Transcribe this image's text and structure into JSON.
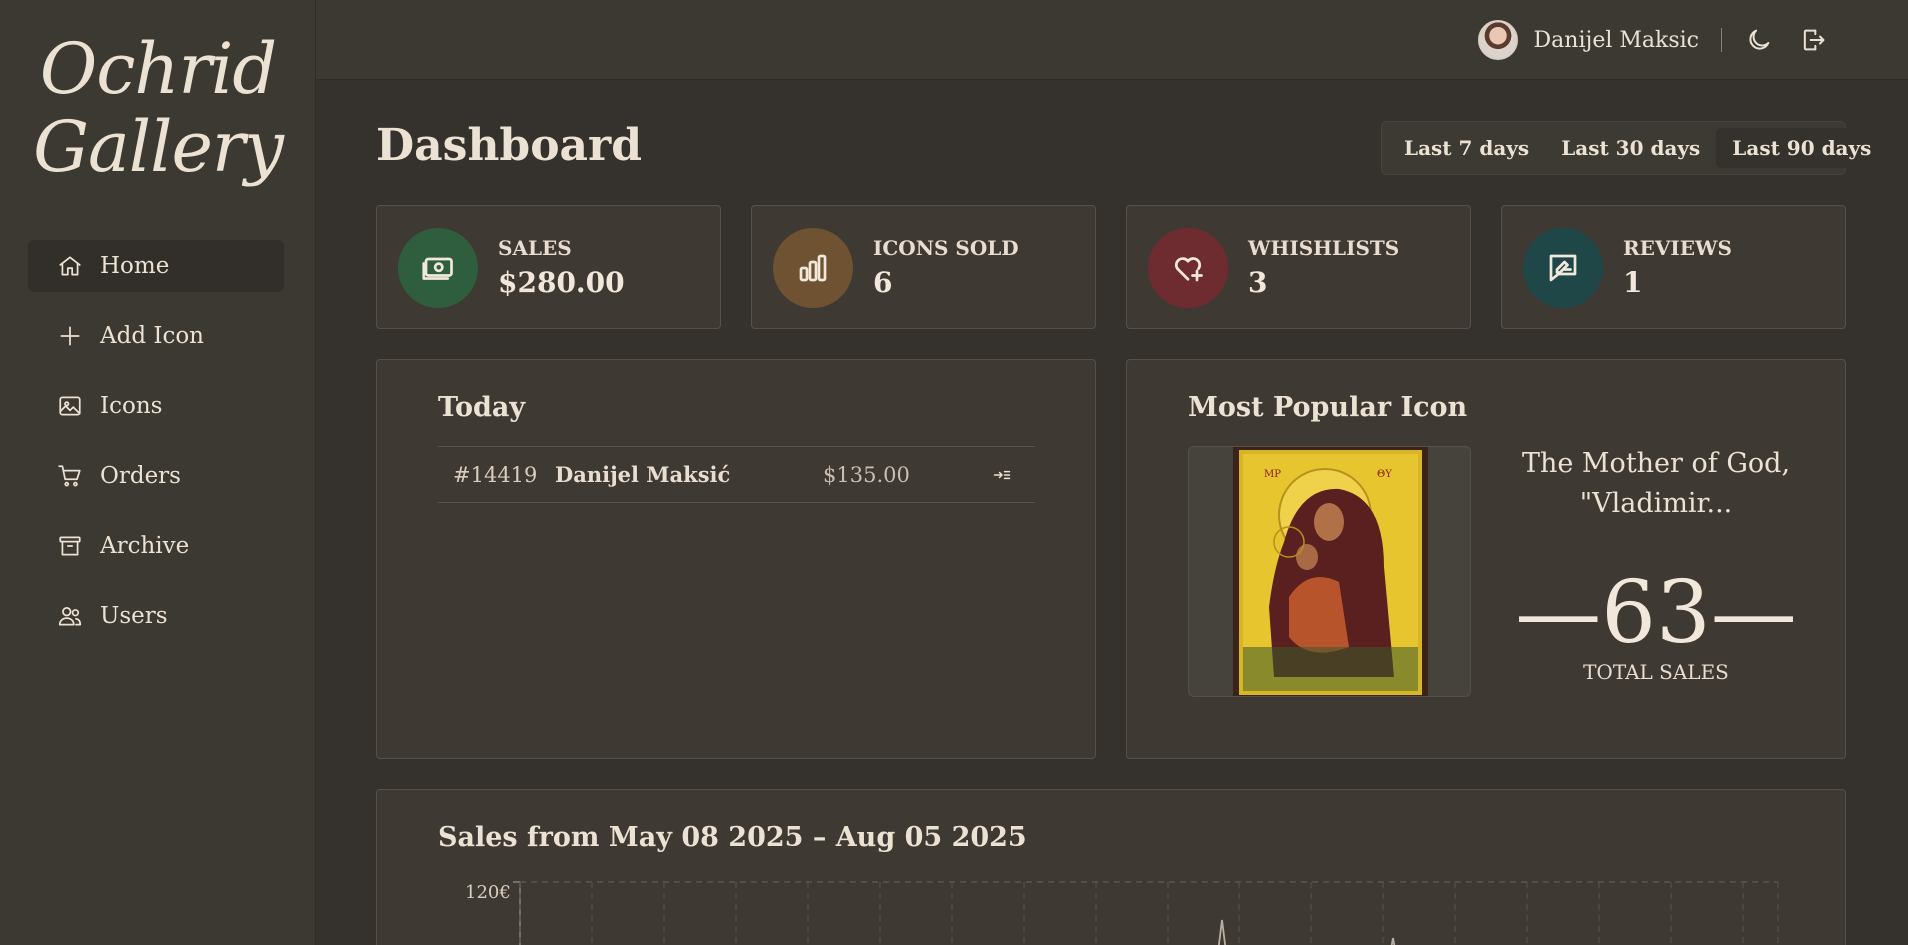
{
  "brand": {
    "name_line1": "Ochrid",
    "name_line2": "Gallery"
  },
  "sidebar": {
    "items": [
      {
        "label": "Home",
        "icon": "home-icon",
        "active": true
      },
      {
        "label": "Add Icon",
        "icon": "plus-icon",
        "active": false
      },
      {
        "label": "Icons",
        "icon": "image-icon",
        "active": false
      },
      {
        "label": "Orders",
        "icon": "cart-icon",
        "active": false
      },
      {
        "label": "Archive",
        "icon": "archive-icon",
        "active": false
      },
      {
        "label": "Users",
        "icon": "users-icon",
        "active": false
      }
    ]
  },
  "topbar": {
    "user_name": "Danijel Maksic",
    "icons": [
      "avatar",
      "moon-icon",
      "logout-icon"
    ]
  },
  "header": {
    "title": "Dashboard",
    "ranges": [
      "Last 7 days",
      "Last 30 days",
      "Last 90 days"
    ],
    "active_range": "Last 90 days"
  },
  "stats": [
    {
      "label": "SALES",
      "value": "$280.00",
      "icon": "money-icon",
      "color": "#2f5e3f"
    },
    {
      "label": "ICONS SOLD",
      "value": "6",
      "icon": "bar-chart-icon",
      "color": "#6e5231"
    },
    {
      "label": "WHISHLISTS",
      "value": "3",
      "icon": "heart-plus-icon",
      "color": "#6e2b30"
    },
    {
      "label": "REVIEWS",
      "value": "1",
      "icon": "review-icon",
      "color": "#1f4748"
    }
  ],
  "today": {
    "title": "Today",
    "orders": [
      {
        "id": "#14419",
        "customer": "Danijel Maksić",
        "amount": "$135.00",
        "action_icon": "open-order-icon"
      }
    ]
  },
  "popular": {
    "title": "Most Popular Icon",
    "name": "The Mother of God, \"Vladimir...",
    "count": "—63—",
    "count_label": "TOTAL SALES"
  },
  "sales_chart": {
    "title": "Sales from May 08 2025 – Aug 05 2025",
    "y_tick_top": "120€"
  },
  "chart_data": {
    "type": "line",
    "title": "Sales from May 08 2025 – Aug 05 2025",
    "xlabel": "",
    "ylabel": "",
    "ylim": [
      0,
      120
    ],
    "y_ticks": [
      "120€"
    ],
    "grid": true
  },
  "colors": {
    "background": "#35312c",
    "panel": "#3f3933",
    "text": "#ece2d4"
  }
}
